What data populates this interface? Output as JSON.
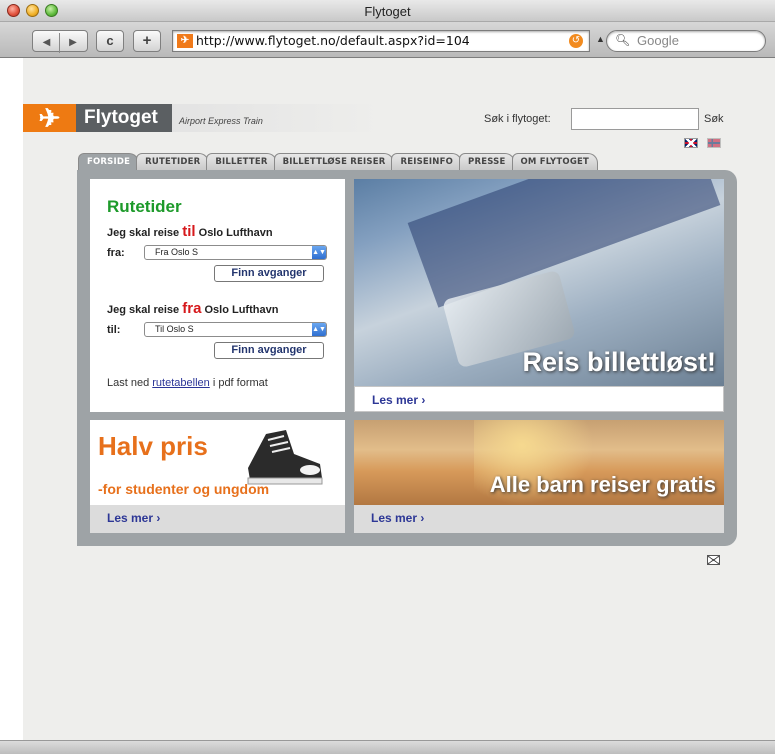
{
  "browser": {
    "window_title": "Flytoget",
    "url": "http://www.flytoget.no/default.aspx?id=104",
    "search_placeholder": "Google",
    "back_glyph": "◀",
    "forward_glyph": "▶",
    "reload_glyph": "c",
    "add_glyph": "+"
  },
  "site": {
    "logo_name": "Flytoget",
    "logo_tagline": "Airport Express Train",
    "search_label": "Søk i flytoget:",
    "search_value": "",
    "search_button": "Søk",
    "languages": [
      "english-flag",
      "norwegian-flag"
    ]
  },
  "tabs": [
    {
      "label": "FORSIDE",
      "active": true
    },
    {
      "label": "RUTETIDER",
      "active": false
    },
    {
      "label": "BILLETTER",
      "active": false
    },
    {
      "label": "BILLETTLØSE REISER",
      "active": false
    },
    {
      "label": "REISEINFO",
      "active": false
    },
    {
      "label": "PRESSE",
      "active": false
    },
    {
      "label": "OM FLYTOGET",
      "active": false
    }
  ],
  "route": {
    "title": "Rutetider",
    "to_lead_before": "Jeg skal reise ",
    "to_lead_em": "til",
    "to_lead_after": " Oslo Lufthavn",
    "from_label": "fra:",
    "from_value": "Fra Oslo S",
    "from_button": "Finn avganger",
    "from_lead_before": "Jeg skal reise ",
    "from_lead_em": "fra",
    "from_lead_after": " Oslo Lufthavn",
    "to_label": "til:",
    "to_value": "Til Oslo S",
    "to_button": "Finn avganger",
    "download_before": "Last ned ",
    "download_link": "rutetabellen",
    "download_after": " i pdf format"
  },
  "banners": {
    "card_headline": "Reis billettløst!",
    "card_more": "Les mer",
    "half_title": "Halv pris",
    "half_sub": "-for studenter og ungdom",
    "half_more": "Les mer",
    "kids_title": "Alle barn reiser gratis",
    "kids_more": "Les mer",
    "more_chevron": "›"
  },
  "colors": {
    "brand_orange": "#ee7a12",
    "route_green": "#1d9a2a",
    "accent_red": "#d6191c",
    "link_blue": "#2d3796"
  }
}
